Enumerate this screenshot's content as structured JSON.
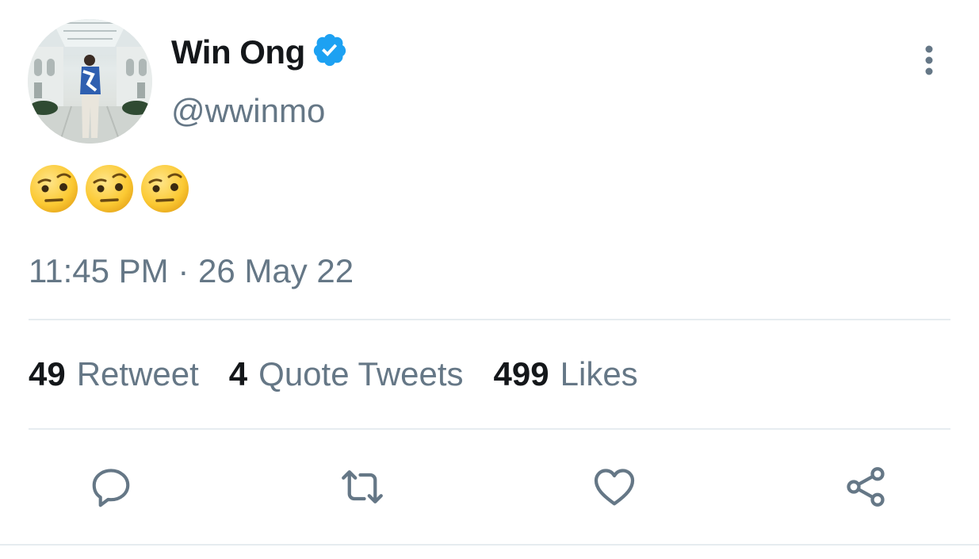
{
  "author": {
    "display_name": "Win Ong",
    "handle": "@wwinmo",
    "verified_icon": "verified-badge-icon",
    "avatar_icon": "profile-photo"
  },
  "tweet": {
    "text_emojis": [
      "🤨",
      "🤨",
      "🤨"
    ],
    "timestamp": "11:45 PM · 26 May 22"
  },
  "stats": [
    {
      "count": "49",
      "label": "Retweet"
    },
    {
      "count": "4",
      "label": "Quote Tweets"
    },
    {
      "count": "499",
      "label": "Likes"
    }
  ],
  "actions": [
    "reply-icon",
    "retweet-icon",
    "like-icon",
    "share-icon"
  ],
  "colors": {
    "primary_text": "#14171a",
    "secondary_text": "#657786",
    "verified_blue": "#1da1f2",
    "divider": "#e6ecf0"
  }
}
